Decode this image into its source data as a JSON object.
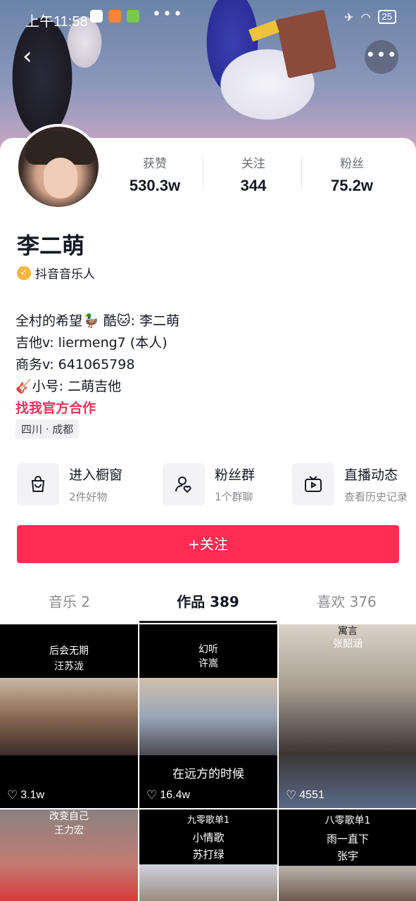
{
  "status_bar": {
    "time": "上午11:58",
    "dots": "•••",
    "battery": "25"
  },
  "header": {
    "back_icon": "back-arrow-icon",
    "more_icon": "more-dots-icon",
    "more_label": "•••"
  },
  "profile": {
    "name": "李二萌",
    "verified_label": "抖音音乐人",
    "stats": [
      {
        "label": "获赞",
        "value": "530.3w"
      },
      {
        "label": "关注",
        "value": "344"
      },
      {
        "label": "粉丝",
        "value": "75.2w"
      }
    ],
    "bio_lines": [
      "全村的希望🦆 酷🐱: 李二萌",
      "吉他v: liermeng7 (本人)",
      "商务v: 641065798",
      "🎸小号: 二萌吉他"
    ],
    "bio_link": "找我官方合作",
    "location": "四川 · 成都"
  },
  "features": [
    {
      "title": "进入橱窗",
      "subtitle": "2件好物",
      "icon": "shopping-bag-icon"
    },
    {
      "title": "粉丝群",
      "subtitle": "1个群聊",
      "icon": "fan-group-icon"
    },
    {
      "title": "直播动态",
      "subtitle": "查看历史记录",
      "icon": "tv-icon"
    }
  ],
  "follow_button": "+关注",
  "tabs": [
    {
      "label": "音乐 2",
      "active": false
    },
    {
      "label": "作品 389",
      "active": true
    },
    {
      "label": "喜欢 376",
      "active": false
    }
  ],
  "videos": [
    {
      "caption": [
        "后会无期",
        "汪苏泷"
      ],
      "overlay": "",
      "likes": "3.1w"
    },
    {
      "caption": [
        "幻听",
        "许嵩"
      ],
      "overlay": "在远方的时候",
      "likes": "16.4w"
    },
    {
      "caption": [
        "寓言",
        "张韶涵"
      ],
      "overlay": "",
      "likes": "4551"
    },
    {
      "caption": [
        "改变自己",
        "王力宏"
      ],
      "overlay": "",
      "likes": ""
    },
    {
      "caption": [
        "九零歌单1",
        "小情歌",
        "苏打绿"
      ],
      "overlay": "",
      "likes": ""
    },
    {
      "caption": [
        "八零歌单1",
        "雨一直下",
        "张宇"
      ],
      "overlay": "",
      "likes": ""
    }
  ],
  "colors": {
    "follow": "#fe2c55",
    "link": "#e6335c",
    "verified": "#f6b73c"
  }
}
